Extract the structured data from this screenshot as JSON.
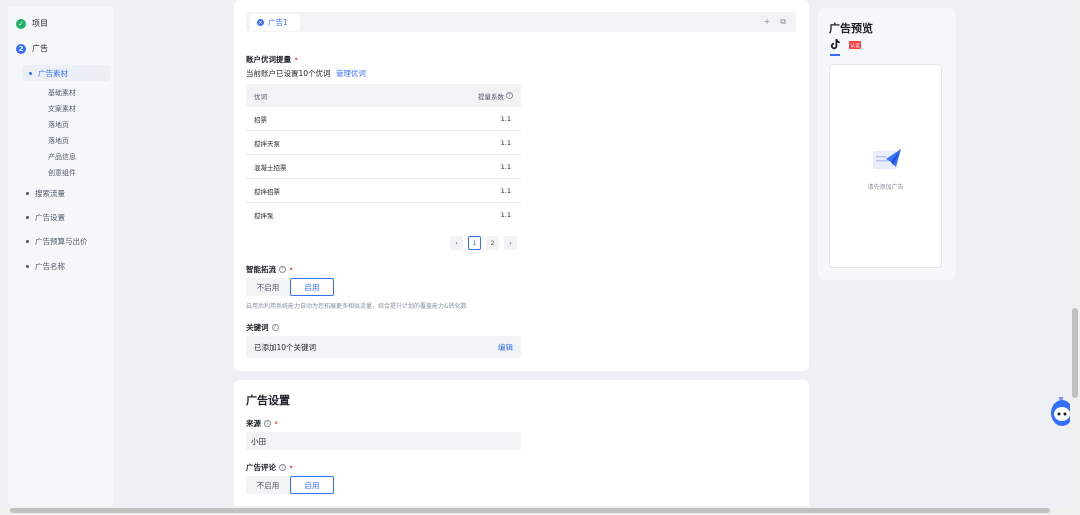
{
  "sidebar": {
    "steps": [
      {
        "number": "✓",
        "label": "项目",
        "status": "done"
      },
      {
        "number": "2",
        "label": "广告",
        "status": "active"
      }
    ],
    "items": [
      {
        "label": "广告素材"
      },
      {
        "label": "搜索流量"
      },
      {
        "label": "广告设置"
      },
      {
        "label": "广告预算与出价"
      },
      {
        "label": "广告名称"
      }
    ],
    "sub_items": [
      {
        "label": "基础素材"
      },
      {
        "label": "文案素材"
      },
      {
        "label": "落地页"
      },
      {
        "label": "落地页"
      },
      {
        "label": "产品信息"
      },
      {
        "label": "创意组件"
      }
    ]
  },
  "tabs": {
    "active": "广告1",
    "add_icon": "+",
    "copy_icon": "⧉"
  },
  "priority_words": {
    "label": "账户优词提量",
    "desc": "当前账户已设置10个优词",
    "manage_link": "管理优词",
    "columns": [
      "优词",
      "提量系数"
    ],
    "rows": [
      {
        "word": "招票",
        "coef": "1.1"
      },
      {
        "word": "搅拌天泵",
        "coef": "1.1"
      },
      {
        "word": "混凝土招票",
        "coef": "1.1"
      },
      {
        "word": "搅拌招票",
        "coef": "1.1"
      },
      {
        "word": "搅拌泵",
        "coef": "1.1"
      }
    ],
    "pages": [
      "1",
      "2"
    ],
    "prev": "‹",
    "next": "›"
  },
  "smart_expand": {
    "label": "智能拓流",
    "options": [
      "不启用",
      "启用"
    ],
    "selected": "启用",
    "hint": "启用后利用系统能力自动为您拓展更多相似流量，综合提升计划的覆盖能力&转化数"
  },
  "keywords": {
    "label": "关键词",
    "summary": "已添加10个关键词",
    "edit": "编辑"
  },
  "ad_settings": {
    "title": "广告设置",
    "source_label": "来源",
    "source_value": "小田",
    "comment_label": "广告评论",
    "comment_options": [
      "不启用",
      "启用"
    ],
    "comment_selected": "启用"
  },
  "preview": {
    "title": "广告预览",
    "badge": "认证",
    "empty_text": "请先添加广告"
  },
  "colors": {
    "primary": "#3370ff",
    "success": "#1fb16a",
    "danger": "#f53f3f"
  }
}
